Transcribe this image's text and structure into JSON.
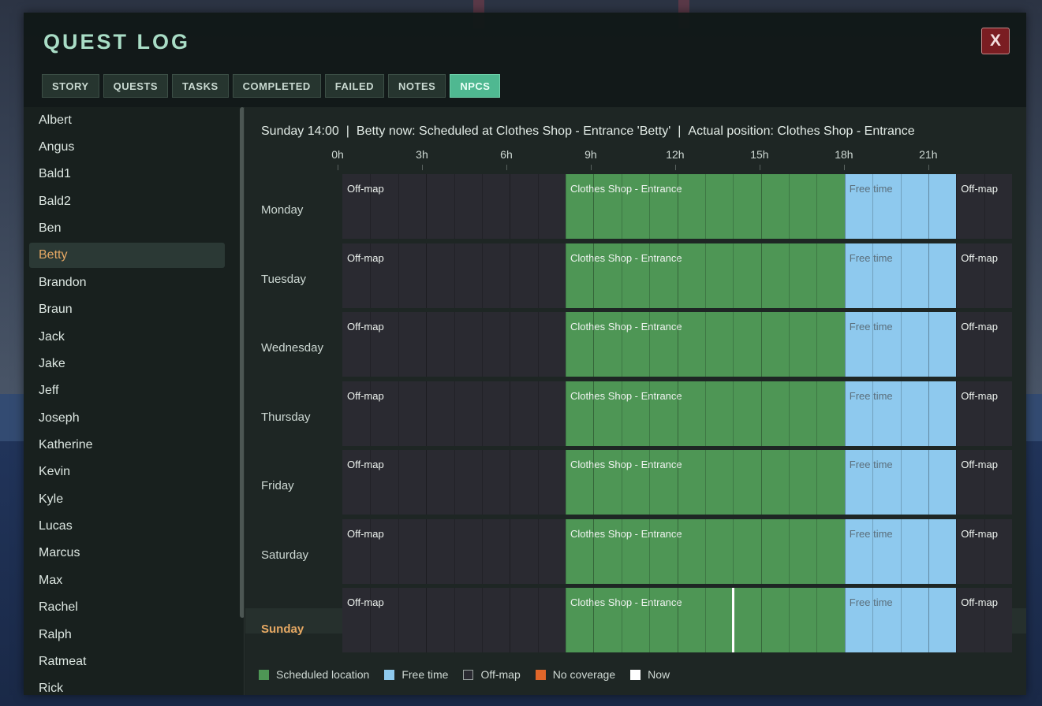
{
  "window": {
    "title": "QUEST LOG",
    "close_label": "X"
  },
  "tabs": [
    {
      "label": "STORY",
      "active": false
    },
    {
      "label": "QUESTS",
      "active": false
    },
    {
      "label": "TASKS",
      "active": false
    },
    {
      "label": "COMPLETED",
      "active": false
    },
    {
      "label": "FAILED",
      "active": false
    },
    {
      "label": "NOTES",
      "active": false
    },
    {
      "label": "NPCS",
      "active": true
    }
  ],
  "npcs": [
    "Albert",
    "Angus",
    "Bald1",
    "Bald2",
    "Ben",
    "Betty",
    "Brandon",
    "Braun",
    "Jack",
    "Jake",
    "Jeff",
    "Joseph",
    "Katherine",
    "Kevin",
    "Kyle",
    "Lucas",
    "Marcus",
    "Max",
    "Rachel",
    "Ralph",
    "Ratmeat",
    "Rick"
  ],
  "selected_npc": "Betty",
  "status": {
    "time": "Sunday 14:00",
    "npc_now": "Betty now: Scheduled at Clothes Shop - Entrance 'Betty'",
    "actual": "Actual position: Clothes Shop - Entrance",
    "separator": "|"
  },
  "timeline": {
    "hour_labels": [
      "0h",
      "3h",
      "6h",
      "9h",
      "12h",
      "15h",
      "18h",
      "21h"
    ],
    "total_hours": 24,
    "now_hour": 14,
    "current_day": "Sunday",
    "days": [
      {
        "name": "Monday",
        "segments": [
          {
            "kind": "offmap",
            "label": "Off-map",
            "start": 0,
            "end": 8
          },
          {
            "kind": "scheduled",
            "label": "Clothes Shop - Entrance",
            "start": 8,
            "end": 18
          },
          {
            "kind": "free",
            "label": "Free time",
            "start": 18,
            "end": 22
          },
          {
            "kind": "offmap",
            "label": "Off-map",
            "start": 22,
            "end": 24
          }
        ]
      },
      {
        "name": "Tuesday",
        "segments": [
          {
            "kind": "offmap",
            "label": "Off-map",
            "start": 0,
            "end": 8
          },
          {
            "kind": "scheduled",
            "label": "Clothes Shop - Entrance",
            "start": 8,
            "end": 18
          },
          {
            "kind": "free",
            "label": "Free time",
            "start": 18,
            "end": 22
          },
          {
            "kind": "offmap",
            "label": "Off-map",
            "start": 22,
            "end": 24
          }
        ]
      },
      {
        "name": "Wednesday",
        "segments": [
          {
            "kind": "offmap",
            "label": "Off-map",
            "start": 0,
            "end": 8
          },
          {
            "kind": "scheduled",
            "label": "Clothes Shop - Entrance",
            "start": 8,
            "end": 18
          },
          {
            "kind": "free",
            "label": "Free time",
            "start": 18,
            "end": 22
          },
          {
            "kind": "offmap",
            "label": "Off-map",
            "start": 22,
            "end": 24
          }
        ]
      },
      {
        "name": "Thursday",
        "segments": [
          {
            "kind": "offmap",
            "label": "Off-map",
            "start": 0,
            "end": 8
          },
          {
            "kind": "scheduled",
            "label": "Clothes Shop - Entrance",
            "start": 8,
            "end": 18
          },
          {
            "kind": "free",
            "label": "Free time",
            "start": 18,
            "end": 22
          },
          {
            "kind": "offmap",
            "label": "Off-map",
            "start": 22,
            "end": 24
          }
        ]
      },
      {
        "name": "Friday",
        "segments": [
          {
            "kind": "offmap",
            "label": "Off-map",
            "start": 0,
            "end": 8
          },
          {
            "kind": "scheduled",
            "label": "Clothes Shop - Entrance",
            "start": 8,
            "end": 18
          },
          {
            "kind": "free",
            "label": "Free time",
            "start": 18,
            "end": 22
          },
          {
            "kind": "offmap",
            "label": "Off-map",
            "start": 22,
            "end": 24
          }
        ]
      },
      {
        "name": "Saturday",
        "segments": [
          {
            "kind": "offmap",
            "label": "Off-map",
            "start": 0,
            "end": 8
          },
          {
            "kind": "scheduled",
            "label": "Clothes Shop - Entrance",
            "start": 8,
            "end": 18
          },
          {
            "kind": "free",
            "label": "Free time",
            "start": 18,
            "end": 22
          },
          {
            "kind": "offmap",
            "label": "Off-map",
            "start": 22,
            "end": 24
          }
        ]
      },
      {
        "name": "Sunday",
        "segments": [
          {
            "kind": "offmap",
            "label": "Off-map",
            "start": 0,
            "end": 8
          },
          {
            "kind": "scheduled",
            "label": "Clothes Shop - Entrance",
            "start": 8,
            "end": 18
          },
          {
            "kind": "free",
            "label": "Free time",
            "start": 18,
            "end": 22
          },
          {
            "kind": "offmap",
            "label": "Off-map",
            "start": 22,
            "end": 24
          }
        ]
      }
    ]
  },
  "legend": [
    {
      "label": "Scheduled location",
      "color": "#4e9655",
      "border": "#4e9655"
    },
    {
      "label": "Free time",
      "color": "#8ec9ee",
      "border": "#8ec9ee"
    },
    {
      "label": "Off-map",
      "color": "#2a2a31",
      "border": "#9aa39f"
    },
    {
      "label": "No coverage",
      "color": "#e0662a",
      "border": "#e0662a"
    },
    {
      "label": "Now",
      "color": "#ffffff",
      "border": "#ffffff"
    }
  ]
}
